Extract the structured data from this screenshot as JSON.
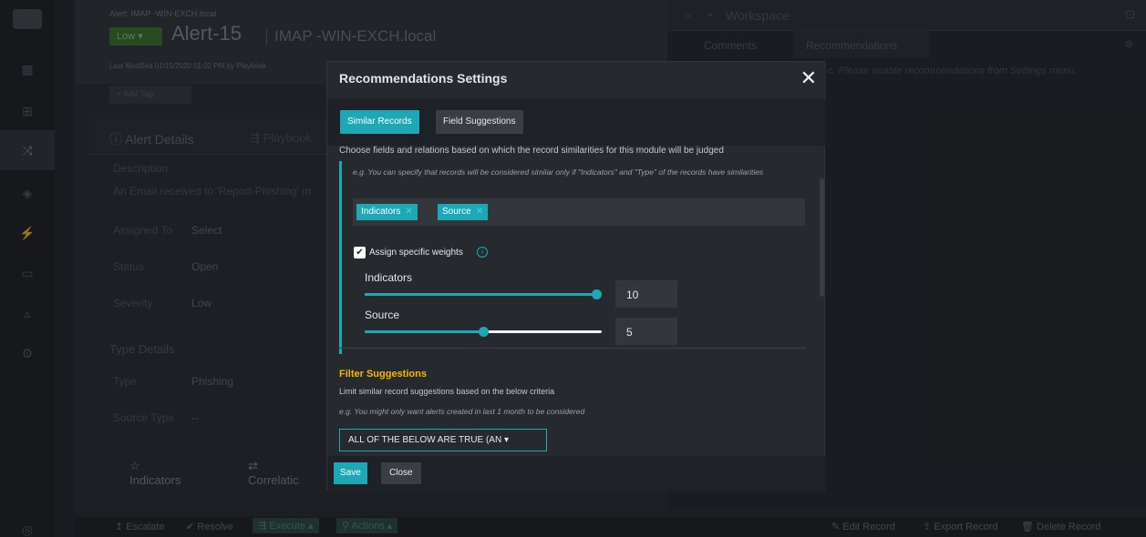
{
  "window": {
    "width": 1257,
    "height": 590
  },
  "alert": {
    "breadcrumb": "Alert: IMAP -WIN-EXCH.local",
    "severity": "Low",
    "title": "Alert-15",
    "host": "IMAP -WIN-EXCH.local",
    "modified": "Last Modified 01/15/2020 01:02 PM by Playbook",
    "add_tag": "+ Add Tag"
  },
  "detail_tabs": {
    "details": "Alert Details",
    "playbook": "Playbook"
  },
  "fields": {
    "description_label": "Description",
    "description_value": "An Email received to 'Report-Phishing' m",
    "assigned_label": "Assigned To",
    "assigned_value": "Select",
    "status_label": "Status",
    "status_value": "Open",
    "severity_label": "Severity",
    "severity_value": "Low",
    "type_details_heading": "Type Details",
    "type_label": "Type",
    "type_value": "Phishing",
    "source_type_label": "Source Type",
    "source_type_value": "--"
  },
  "bottom_tabs": {
    "indicators": "Indicators",
    "correlations": "Correlatic"
  },
  "workspace": {
    "title": "Workspace",
    "tab_comments": "Comments",
    "tab_recommendations": "Recommendations",
    "message": "c. Please enable recommendations from Settings menu."
  },
  "footer": {
    "escalate": "Escalate",
    "resolve": "Resolve",
    "execute": "Execute",
    "actions": "Actions",
    "edit": "Edit Record",
    "export": "Export Record",
    "delete": "Delete Record"
  },
  "modal": {
    "title": "Recommendations Settings",
    "close_symbol": "✕",
    "tab_similar": "Similar Records",
    "tab_fields": "Field Suggestions",
    "description": "Choose fields and relations based on which the record similarities for this module will be judged",
    "example": "e.g. You can specify that records will be considered similar only if \"Indicators\" and \"Type\" of the records have similarities",
    "chips": [
      "Indicators",
      "Source"
    ],
    "assign_weights_label": "Assign specific weights",
    "assign_weights_checked": true,
    "weights": [
      {
        "label": "Indicators",
        "value": "10",
        "level": 1.0
      },
      {
        "label": "Source",
        "value": "5",
        "level": 0.5
      }
    ],
    "filter_title": "Filter Suggestions",
    "filter_desc": "Limit similar record suggestions based on the below criteria",
    "filter_example": "e.g. You might only want alerts created in last 1 month to be considered",
    "filter_dropdown": "ALL OF THE BELOW ARE TRUE (AN",
    "save": "Save",
    "close": "Close"
  },
  "colors": {
    "accent": "#1ca8b5",
    "warning": "#f5b800",
    "severity_low": "#3f7d2c"
  }
}
